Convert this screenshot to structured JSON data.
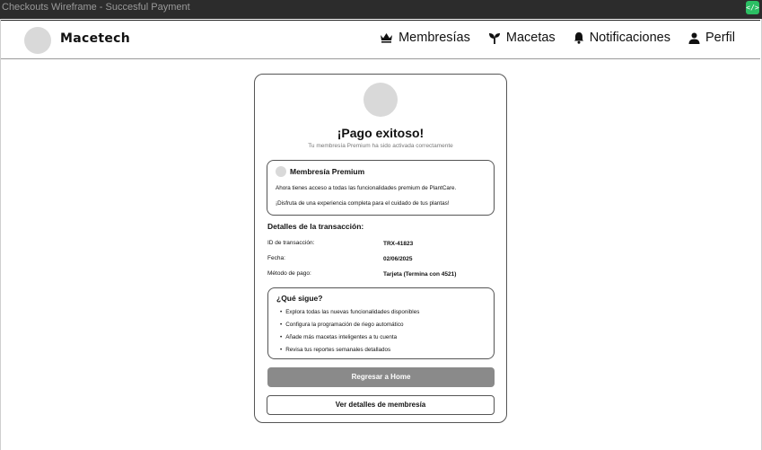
{
  "window": {
    "title": "Checkouts Wireframe - Succesful Payment",
    "badge_icon": "code-icon"
  },
  "nav": {
    "brand": "Macetech",
    "items": [
      {
        "label": "Membresías",
        "icon": "crown-icon"
      },
      {
        "label": "Macetas",
        "icon": "sprout-icon"
      },
      {
        "label": "Notificaciones",
        "icon": "bell-icon"
      },
      {
        "label": "Perfil",
        "icon": "user-icon"
      }
    ]
  },
  "card": {
    "title": "¡Pago exitoso!",
    "subtitle": "Tu membresía Premium ha sido activada correctamente",
    "premium": {
      "title": "Membresía Premium",
      "line1": "Ahora tienes acceso a todas las funcionalidades premium de PlantCare.",
      "line2": "¡Disfruta de una experiencia completa para el cuidado de tus plantas!"
    },
    "details": {
      "title": "Detalles de la transacción:",
      "rows": [
        {
          "label": "ID de transacción:",
          "value": "TRX-41823"
        },
        {
          "label": "Fecha:",
          "value": "02/06/2025"
        },
        {
          "label": "Método de pago:",
          "value": "Tarjeta (Termina con 4521)"
        }
      ]
    },
    "next": {
      "title": "¿Qué sigue?",
      "items": [
        "Explora todas las nuevas funcionalidades disponibles",
        "Configura la programación de riego automático",
        "Añade más macetas inteligentes a tu cuenta",
        "Revisa tus reportes semanales detallados"
      ]
    },
    "buttons": {
      "home": "Regresar a Home",
      "details": "Ver detalles de membresía"
    }
  }
}
